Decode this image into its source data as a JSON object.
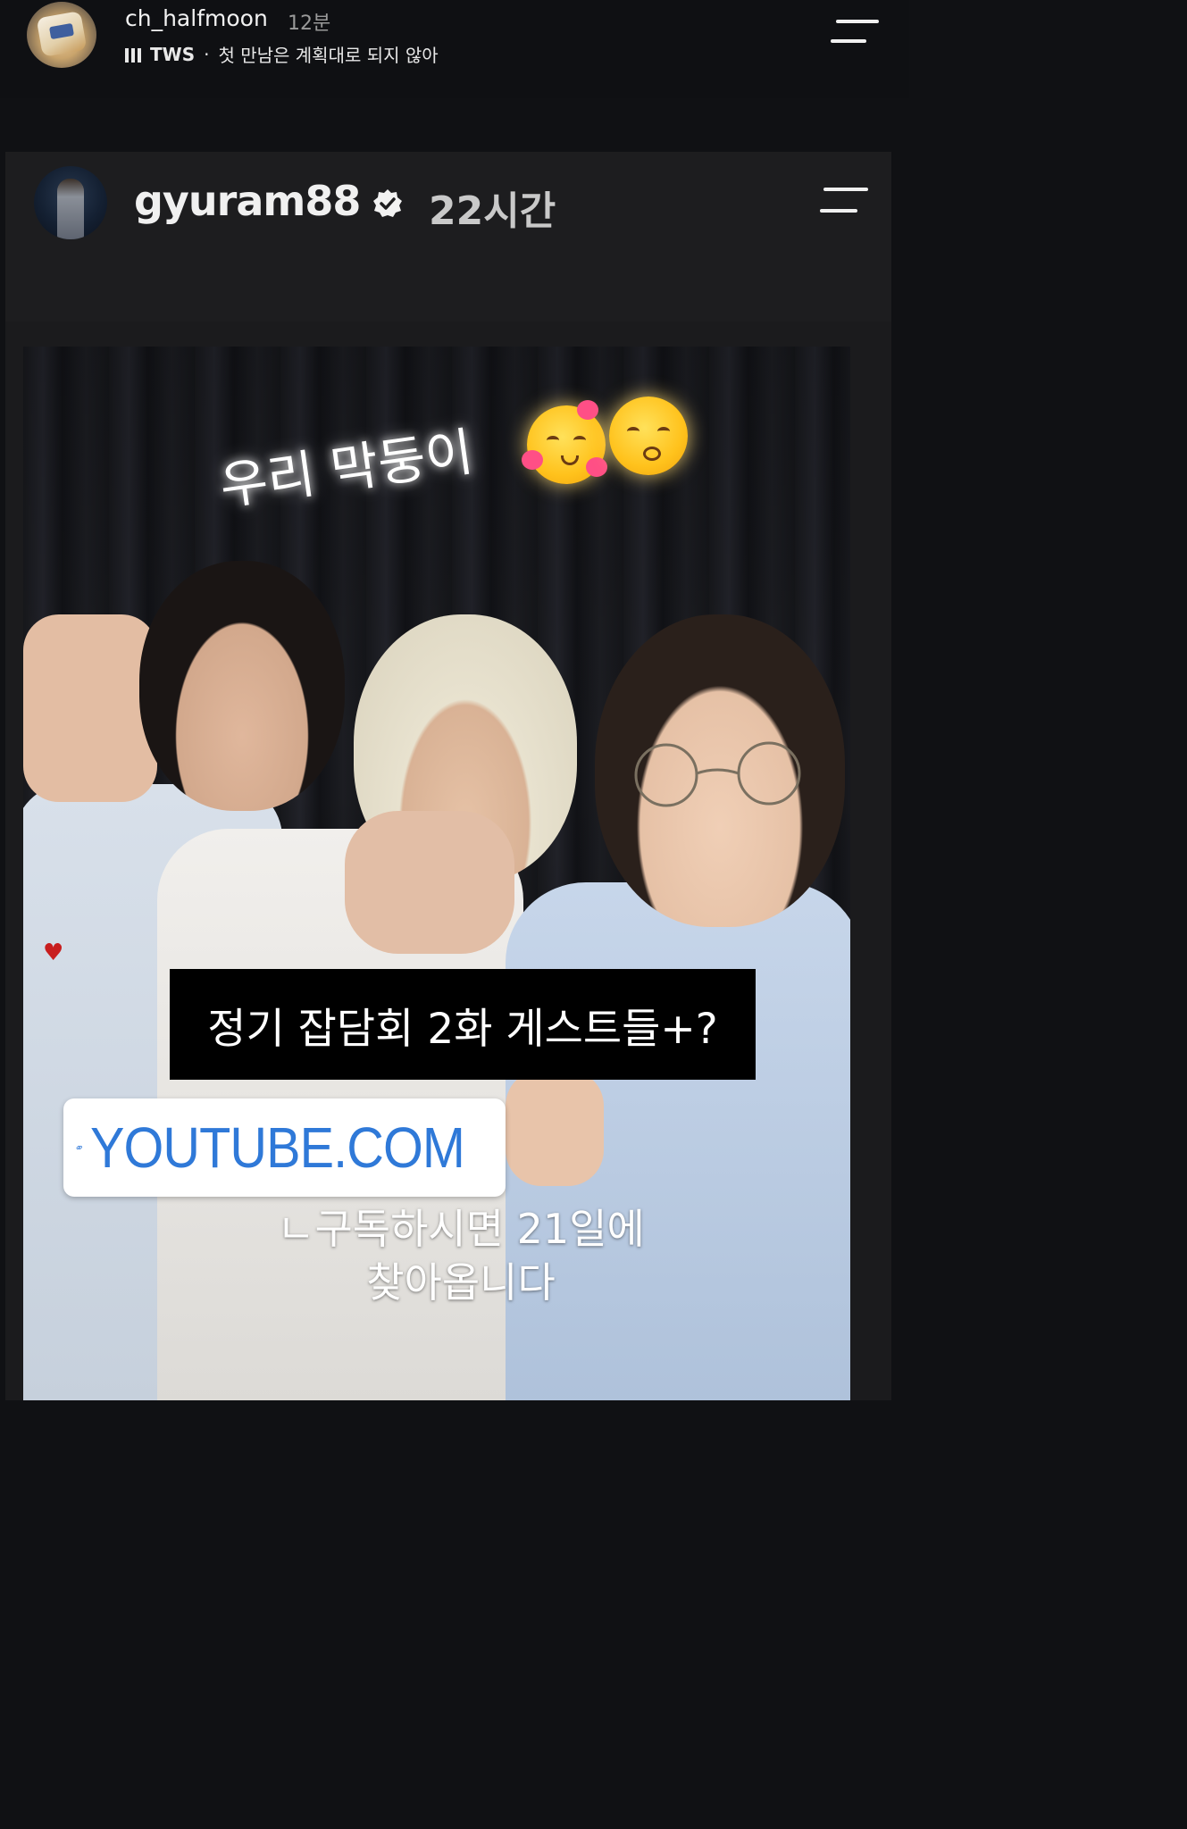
{
  "outer_story": {
    "username": "ch_halfmoon",
    "time": "12분",
    "music": {
      "artist": "TWS",
      "separator": "·",
      "song": "첫 만남은 계획대로 되지 않아"
    },
    "icons": [
      "music-bars-icon",
      "menu-icon"
    ]
  },
  "shared_story": {
    "username": "gyuram88",
    "verified": true,
    "time": "22시간",
    "icons": [
      "verified-badge-icon",
      "menu-icon",
      "link-icon",
      "smiling-face-with-hearts-emoji",
      "kissing-face-emoji"
    ],
    "caption_top": "우리 막둥이",
    "guest_banner": "정기 잡담회 2화 게스트들+?",
    "link_sticker": "YOUTUBE.COM",
    "sub_caption_line1": "ㄴ구독하시면 21일에",
    "sub_caption_line2": "찾아옵니다"
  },
  "colors": {
    "background": "#101114",
    "card": "#1b1b1d",
    "link_blue": "#2f79d8"
  }
}
